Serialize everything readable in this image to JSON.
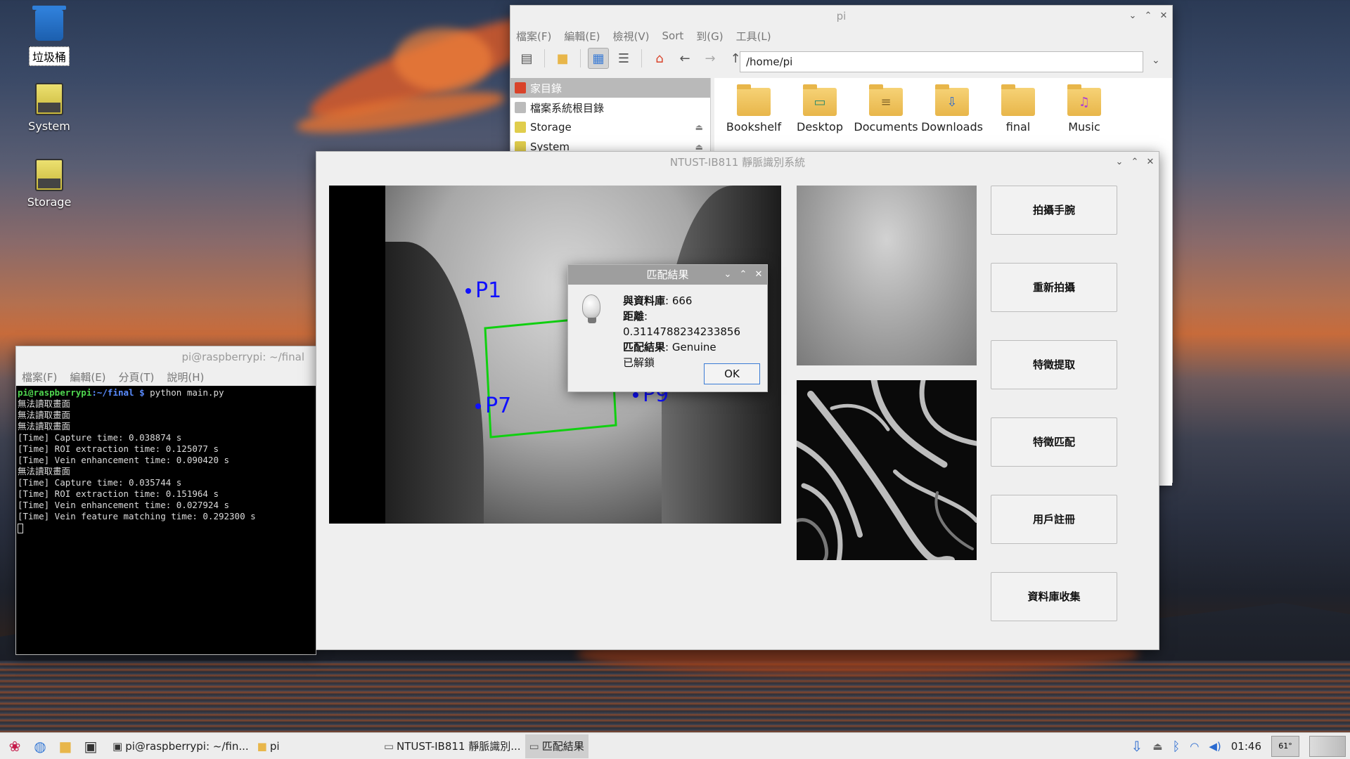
{
  "desktop": {
    "icons": [
      {
        "label": "垃圾桶"
      },
      {
        "label": "System"
      },
      {
        "label": "Storage"
      }
    ]
  },
  "file_manager": {
    "title": "pi",
    "menu": [
      "檔案(F)",
      "編輯(E)",
      "檢視(V)",
      "Sort",
      "到(G)",
      "工具(L)"
    ],
    "path": "/home/pi",
    "sidebar": [
      {
        "label": "家目錄"
      },
      {
        "label": "檔案系統根目錄"
      },
      {
        "label": "Storage"
      },
      {
        "label": "System"
      }
    ],
    "files": [
      "Bookshelf",
      "Desktop",
      "Documents",
      "Downloads",
      "final",
      "Music"
    ]
  },
  "terminal": {
    "title": "pi@raspberrypi: ~/final",
    "menu": [
      "檔案(F)",
      "編輯(E)",
      "分頁(T)",
      "說明(H)"
    ],
    "prompt_user": "pi@raspberrypi",
    "prompt_path": ":~/final $",
    "command": " python main.py",
    "lines": [
      "無法讀取畫面",
      "無法讀取畫面",
      "無法讀取畫面",
      "[Time] Capture time: 0.038874 s",
      "[Time] ROI extraction time: 0.125077 s",
      "[Time] Vein enhancement time: 0.090420 s",
      "無法讀取畫面",
      "[Time] Capture time: 0.035744 s",
      "[Time] ROI extraction time: 0.151964 s",
      "[Time] Vein enhancement time: 0.027924 s",
      "[Time] Vein feature matching time: 0.292300 s"
    ]
  },
  "vein_app": {
    "title": "NTUST-IB811 靜脈識別系統",
    "points": {
      "p1": "P1",
      "p7": "P7",
      "p9": "P9"
    },
    "buttons": [
      "拍攝手腕",
      "重新拍攝",
      "特徵提取",
      "特徵匹配",
      "用戶註冊",
      "資料庫收集"
    ]
  },
  "dialog": {
    "title": "匹配結果",
    "db_label": "與資料庫",
    "db_value": ": 666",
    "dist_label": "距離",
    "dist_value": ": 0.3114788234233856",
    "result_label": "匹配結果",
    "result_value": ": Genuine",
    "status": "已解鎖",
    "ok": "OK"
  },
  "taskbar": {
    "tasks": [
      "pi@raspberrypi: ~/fin...",
      "pi",
      "NTUST-IB811 靜脈識別...",
      "匹配結果"
    ],
    "clock": "01:46",
    "cpu_temp": "61°"
  }
}
